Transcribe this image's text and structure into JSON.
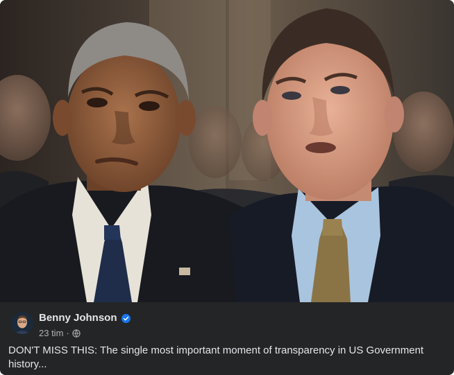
{
  "post": {
    "author": "Benny Johnson",
    "verified_icon": "verified-badge-icon",
    "time": "23 tim",
    "separator": "·",
    "audience_icon": "globe-icon",
    "caption": "DON'T MISS THIS: The single most important moment of transparency in US Government history..."
  },
  "colors": {
    "card_bg": "#242526",
    "text_primary": "#e4e6eb",
    "text_secondary": "#b0b3b8",
    "verified": "#1877f2"
  }
}
